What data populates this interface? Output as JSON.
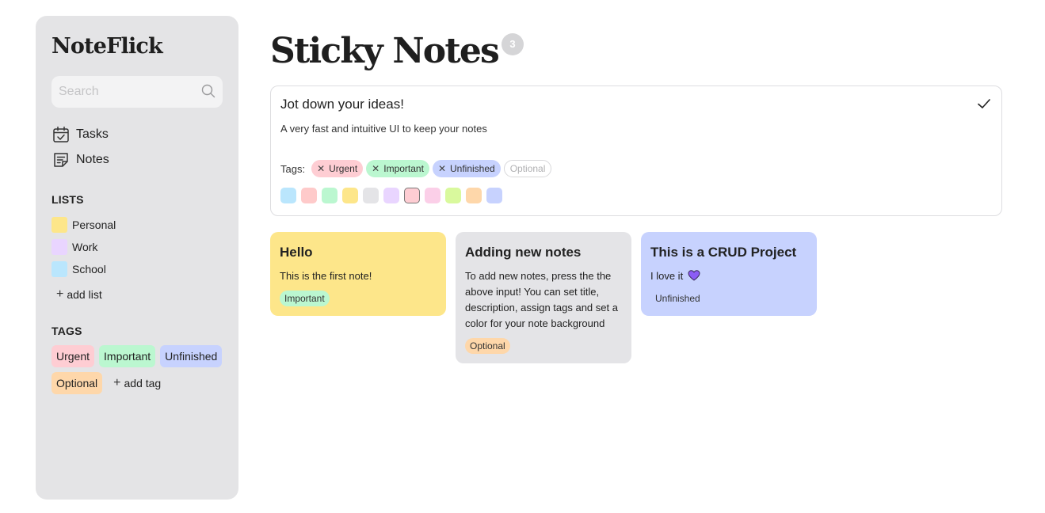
{
  "app": {
    "title": "NoteFlick"
  },
  "search": {
    "placeholder": "Search",
    "value": ""
  },
  "nav": [
    {
      "label": "Tasks",
      "icon": "calendar-check-icon"
    },
    {
      "label": "Notes",
      "icon": "sticky-note-icon"
    }
  ],
  "lists": {
    "heading": "LISTS",
    "items": [
      {
        "label": "Personal",
        "color": "#fde68a"
      },
      {
        "label": "Work",
        "color": "#e9d5ff"
      },
      {
        "label": "School",
        "color": "#bae6fd"
      }
    ],
    "add_label": "add list"
  },
  "tags": {
    "heading": "TAGS",
    "items": [
      {
        "label": "Urgent",
        "color": "#fecdd3"
      },
      {
        "label": "Important",
        "color": "#bbf7d0"
      },
      {
        "label": "Unfinished",
        "color": "#c7d2fe"
      },
      {
        "label": "Optional",
        "color": "#fed7aa"
      }
    ],
    "add_label": "add tag"
  },
  "page": {
    "title": "Sticky Notes",
    "count": "3"
  },
  "composer": {
    "title_value": "Jot down your ideas!",
    "description_value": "A very fast and intuitive UI to keep your notes",
    "tags_label": "Tags:",
    "selected_tags": [
      {
        "label": "Urgent",
        "color": "#fecdd3"
      },
      {
        "label": "Important",
        "color": "#bbf7d0"
      },
      {
        "label": "Unfinished",
        "color": "#c7d2fe"
      }
    ],
    "optional_tag": {
      "label": "Optional"
    },
    "colors": [
      "#bae6fd",
      "#fecaca",
      "#bbf7d0",
      "#fde68a",
      "#e4e4e7",
      "#e9d5ff",
      "#fbcfe8",
      "#fbcfe8",
      "#d9f99d",
      "#fed7aa",
      "#c7d2fe"
    ],
    "selected_color_index": 6
  },
  "notes": [
    {
      "title": "Hello",
      "body": "This is the first note!",
      "tag": "Important",
      "tag_color": "#bbf7d0",
      "color": "#fde68a"
    },
    {
      "title": "Adding new notes",
      "body": "To add new notes, press the the above input! You can set title, description, assign tags and set a color for your note background",
      "tag": "Optional",
      "tag_color": "#fed7aa",
      "color": "#e4e4e7"
    },
    {
      "title": "This is a CRUD Project",
      "body": "I love it",
      "body_icon": "purple-heart-icon",
      "tag": "Unfinished",
      "tag_color": "#c7d2fe",
      "color": "#c7d2fe"
    }
  ]
}
